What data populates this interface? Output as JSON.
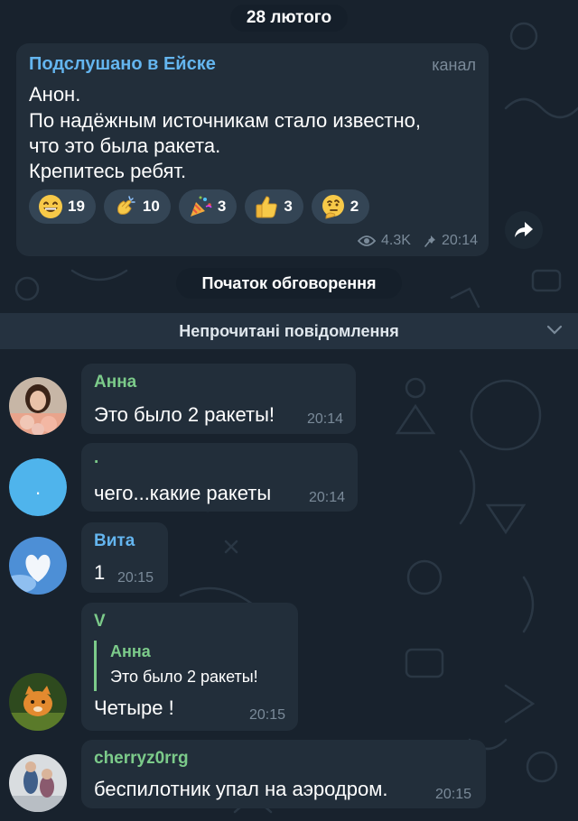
{
  "date_header": "28 лютого",
  "channel_post": {
    "channel_name": "Подслушано в Ейске",
    "channel_type": "канал",
    "lines": [
      "Анон.",
      "По надёжным источникам стало известно,",
      "что это была ракета.",
      "Крепитесь ребят."
    ],
    "reactions": [
      {
        "emoji": "grinning-face",
        "count": "19"
      },
      {
        "emoji": "clapping-hands",
        "count": "10"
      },
      {
        "emoji": "party-popper",
        "count": "3"
      },
      {
        "emoji": "thumbs-up",
        "count": "3"
      },
      {
        "emoji": "thinking-face",
        "count": "2"
      }
    ],
    "views": "4.3K",
    "time": "20:14"
  },
  "discussion_start": "Початок обговорення",
  "unread_label": "Непрочитані повідомлення",
  "messages": [
    {
      "author": "Анна",
      "author_color": "#7ccb8a",
      "text": "Это было 2 ракеты!",
      "time": "20:14"
    },
    {
      "author": ".",
      "author_color": "#7ccb8a",
      "text": "чего...какие ракеты",
      "time": "20:14"
    },
    {
      "author": "Вита",
      "author_color": "#64b5ef",
      "text": "1",
      "time": "20:15"
    },
    {
      "author": "V",
      "author_color": "#7ccb8a",
      "reply_author": "Анна",
      "reply_text": "Это было 2 ракеты!",
      "text": "Четыре !",
      "time": "20:15"
    },
    {
      "author": "cherryz0rrg",
      "author_color": "#7ccb8a",
      "text": "беспилотник упал на аэродром.",
      "time": "20:15"
    }
  ],
  "colors": {
    "background": "#18222d",
    "bubble": "#222e3a",
    "channel_name": "#64b5ef",
    "meta": "#7a8a99",
    "reaction_pill": "#344555"
  }
}
